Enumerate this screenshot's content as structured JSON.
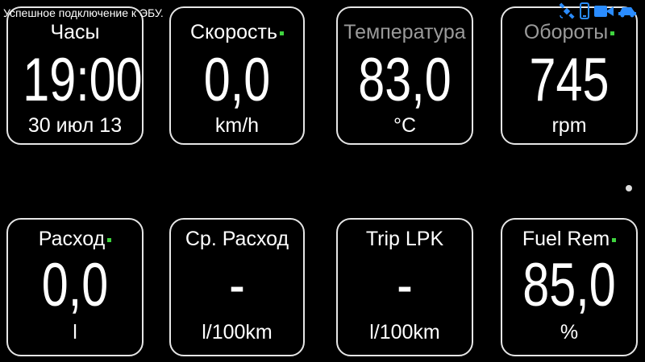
{
  "status": {
    "message": "Успешное подключение к ЭБУ.",
    "icons": [
      "satellite-icon",
      "phone-icon",
      "camera-icon",
      "car-icon"
    ],
    "icon_color": "#2a8cff"
  },
  "marker_color": "#3fd43f",
  "tiles": [
    {
      "title": "Часы",
      "value": "19:00",
      "unit": "30 июл 13",
      "marker": false
    },
    {
      "title": "Скорость",
      "value": "0,0",
      "unit": "km/h",
      "marker": true
    },
    {
      "title": "Температура",
      "value": "83,0",
      "unit": "°C",
      "marker": false
    },
    {
      "title": "Обороты",
      "value": "745",
      "unit": "rpm",
      "marker": true
    },
    {
      "title": "Расход",
      "value": "0,0",
      "unit": "l",
      "marker": true
    },
    {
      "title": "Ср. Расход",
      "value": "-",
      "unit": "l/100km",
      "marker": false
    },
    {
      "title": "Trip LPK",
      "value": "-",
      "unit": "l/100km",
      "marker": false
    },
    {
      "title": "Fuel Rem",
      "value": "85,0",
      "unit": "%",
      "marker": true
    }
  ]
}
